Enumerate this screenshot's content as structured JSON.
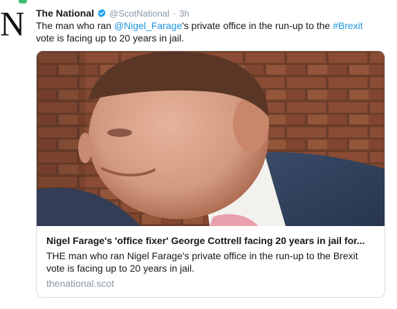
{
  "account": {
    "avatar_letter": "N",
    "name": "The National",
    "handle": "@ScotNational",
    "separator": "·",
    "time": "3h"
  },
  "tweet": {
    "text_before": "The man who ran ",
    "mention": "@Nigel_Farage",
    "text_middle": "'s private office in the run-up to the ",
    "hashtag": "#Brexit",
    "text_after": " vote is facing up to 20 years in jail."
  },
  "card": {
    "title": "Nigel Farage's 'office fixer' George Cottrell facing 20 years in jail for...",
    "description": "THE man who ran Nigel Farage's private office in the run-up to the Brexit vote is facing up to 20 years in jail.",
    "domain": "thenational.scot"
  },
  "colors": {
    "link": "#1b95e0",
    "verified": "#1da1f2",
    "meta_gray": "#8a98a5",
    "accent_green": "#3cc06a"
  },
  "icons": {
    "verified": "verified-badge-icon"
  }
}
